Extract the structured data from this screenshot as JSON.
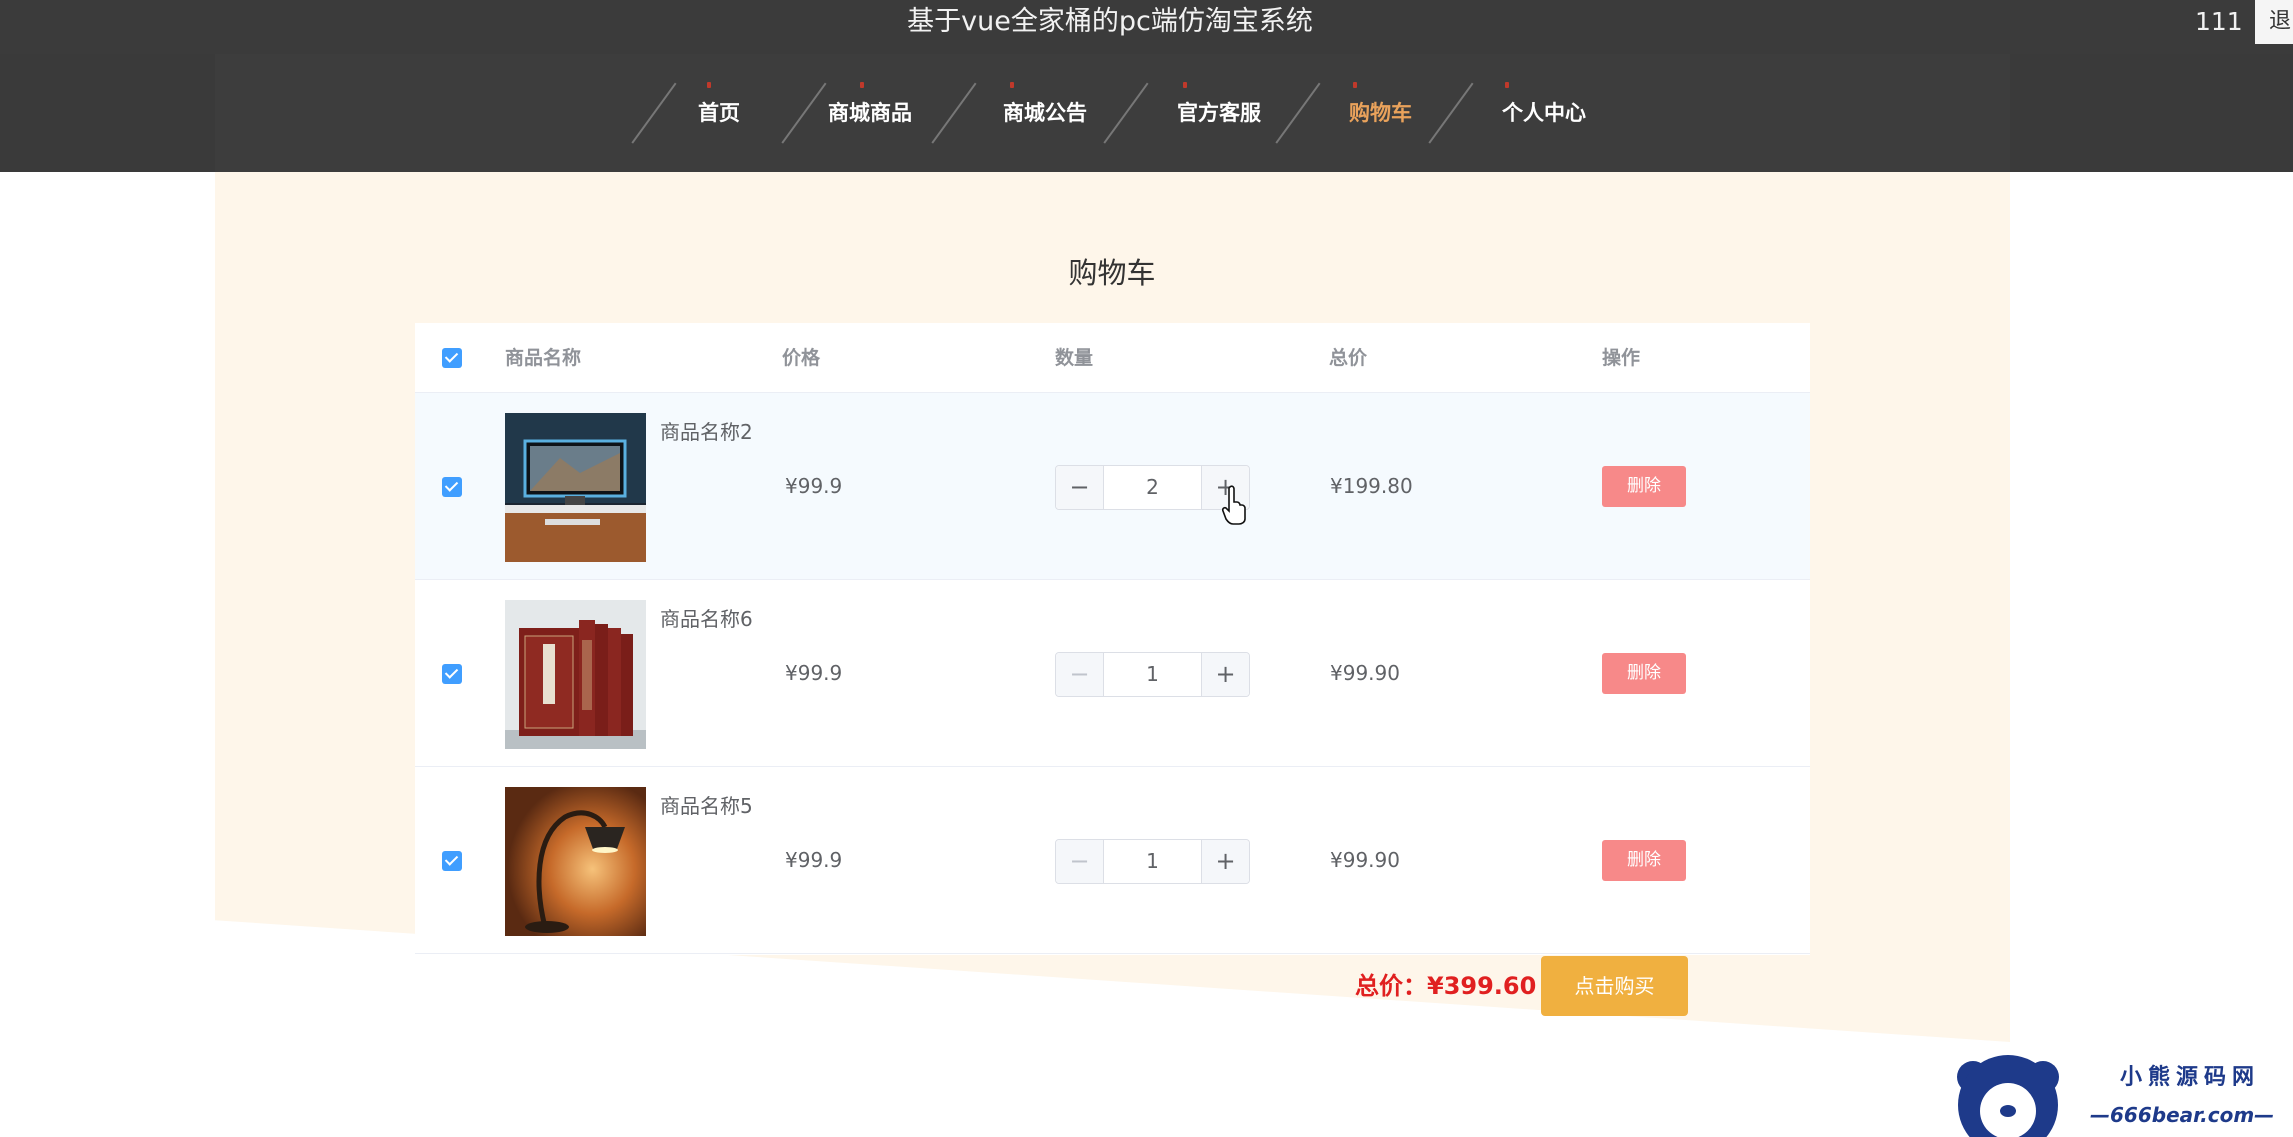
{
  "header": {
    "site_title": "基于vue全家桶的pc端仿淘宝系统",
    "user_name": "111",
    "logout_label": "退出"
  },
  "nav": {
    "items": [
      {
        "label": "首页"
      },
      {
        "label": "商城商品"
      },
      {
        "label": "商城公告"
      },
      {
        "label": "官方客服"
      },
      {
        "label": "购物车",
        "active": true
      },
      {
        "label": "个人中心"
      }
    ],
    "active_color": "#e9a25b"
  },
  "cart": {
    "title": "购物车",
    "columns": {
      "name": "商品名称",
      "price": "价格",
      "quantity": "数量",
      "total": "总价",
      "action": "操作"
    },
    "select_all_checked": true,
    "items": [
      {
        "name": "商品名称2",
        "price": "¥99.9",
        "quantity": "2",
        "subtotal": "¥199.80",
        "delete_label": "删除",
        "checked": true,
        "thumb_icon": "monitor-desk-image"
      },
      {
        "name": "商品名称6",
        "price": "¥99.9",
        "quantity": "1",
        "subtotal": "¥99.90",
        "delete_label": "删除",
        "checked": true,
        "thumb_icon": "books-image"
      },
      {
        "name": "商品名称5",
        "price": "¥99.9",
        "quantity": "1",
        "subtotal": "¥99.90",
        "delete_label": "删除",
        "checked": true,
        "thumb_icon": "desk-lamp-image"
      }
    ],
    "total_label": "总价：",
    "total_value": "¥399.60",
    "buy_label": "点击购买"
  },
  "watermark": {
    "brand": "小熊源码网",
    "url": "—666bear.com—"
  },
  "colors": {
    "topbar": "#3b3b3b",
    "page_bg": "#fef6ea",
    "checkbox": "#409eff",
    "delete": "#f78989",
    "buy": "#f0b040",
    "total": "#e02020"
  }
}
